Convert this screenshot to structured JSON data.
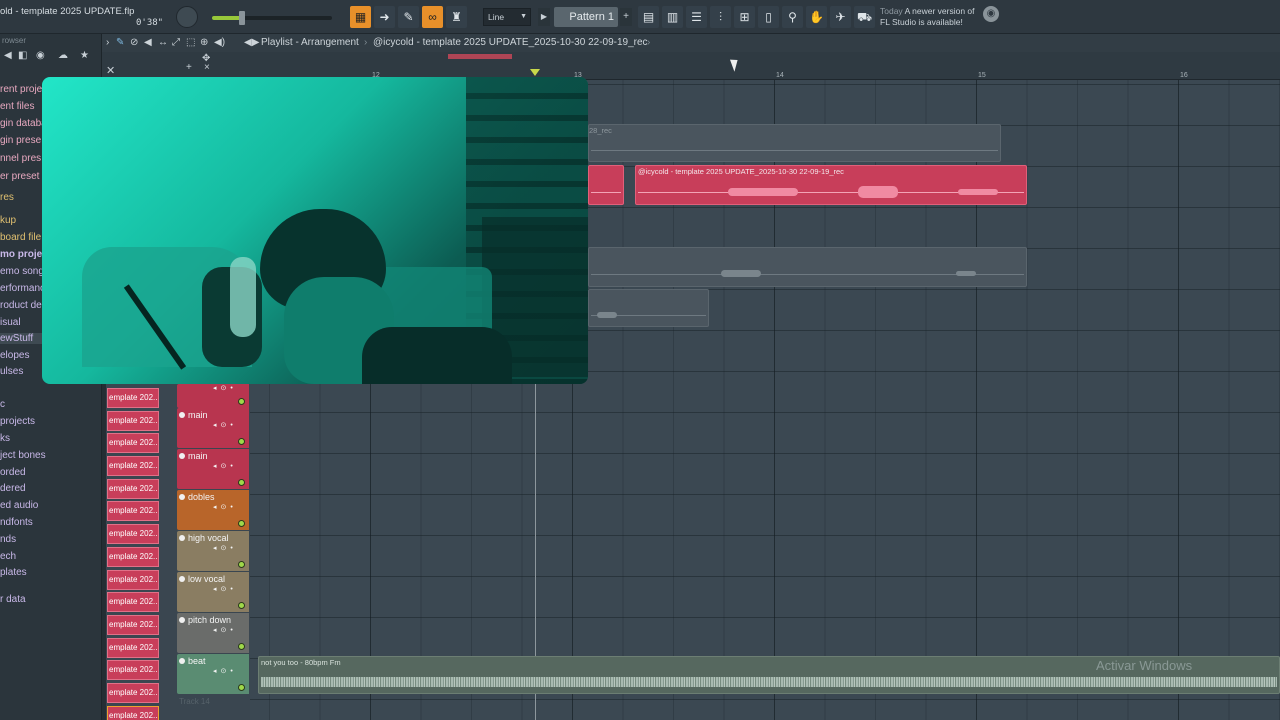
{
  "titlebar": {
    "file": "old - template 2025 UPDATE.flp",
    "time": "0'38\""
  },
  "master": {
    "volume_fraction": 0.25
  },
  "toolbar": {
    "snap": "Line",
    "pattern": "Pattern 1",
    "news_today": "Today",
    "news_text": "A newer version of FL Studio is available!",
    "accent": "#e8902a"
  },
  "browser": {
    "header": "rowser",
    "items": [
      "rent proje",
      "ent files",
      "gin databa",
      "gin prese",
      "nnel pres",
      "er preset",
      "res",
      "kup",
      "board file",
      "mo project",
      "emo song",
      "erformanc",
      "roduct de",
      "isual",
      "ewStuff",
      "elopes",
      "ulses",
      "c",
      " projects",
      "ks",
      "ject bones",
      "orded",
      "dered",
      "ed audio",
      "ndfonts",
      "nds",
      "ech",
      "plates",
      "r data"
    ]
  },
  "playlist": {
    "title": "Playlist - Arrangement",
    "clip_path": "@icycold - template 2025 UPDATE_2025-10-30 22-09-19_rec",
    "bars": [
      "12",
      "13",
      "14",
      "15",
      "16"
    ]
  },
  "clips": {
    "top_grey_label": "28_rec",
    "rec_label": "@icycold - template 2025 UPDATE_2025-10-30 22-09-19_rec",
    "beat_label": "not you too - 80bpm Fm"
  },
  "channel_label": "emplate 202...",
  "tracks": [
    {
      "name": "main",
      "color": "red"
    },
    {
      "name": "main",
      "color": "red"
    },
    {
      "name": "dobles",
      "color": "orange"
    },
    {
      "name": "high vocal",
      "color": "tan"
    },
    {
      "name": "low vocal",
      "color": "tan"
    },
    {
      "name": "pitch down",
      "color": "grey"
    },
    {
      "name": "beat",
      "color": "green"
    }
  ],
  "next_track": "Track 14",
  "watermark": "Activar Windows"
}
